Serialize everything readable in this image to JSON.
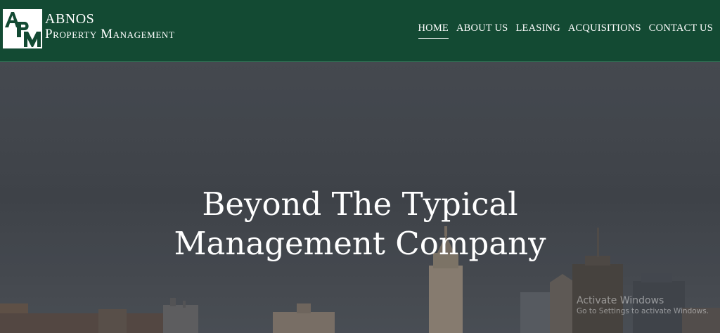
{
  "brand": {
    "logo_mark_letters": "APM",
    "name_line1": "ABNOS",
    "name_line2": "Property Management",
    "colors": {
      "header_bg": "#134a33",
      "logo_mark_fg": "#134a33",
      "text": "#ffffff"
    }
  },
  "nav": {
    "items": [
      {
        "label": "HOME",
        "active": true
      },
      {
        "label": "ABOUT US",
        "active": false
      },
      {
        "label": "LEASING",
        "active": false
      },
      {
        "label": "ACQUISITIONS",
        "active": false
      },
      {
        "label": "CONTACT US",
        "active": false
      }
    ]
  },
  "hero": {
    "title_line1": "Beyond The Typical",
    "title_line2": "Management Company",
    "background": "city-skyline-photo"
  },
  "os_watermark": {
    "line1": "Activate Windows",
    "line2": "Go to Settings to activate Windows."
  }
}
